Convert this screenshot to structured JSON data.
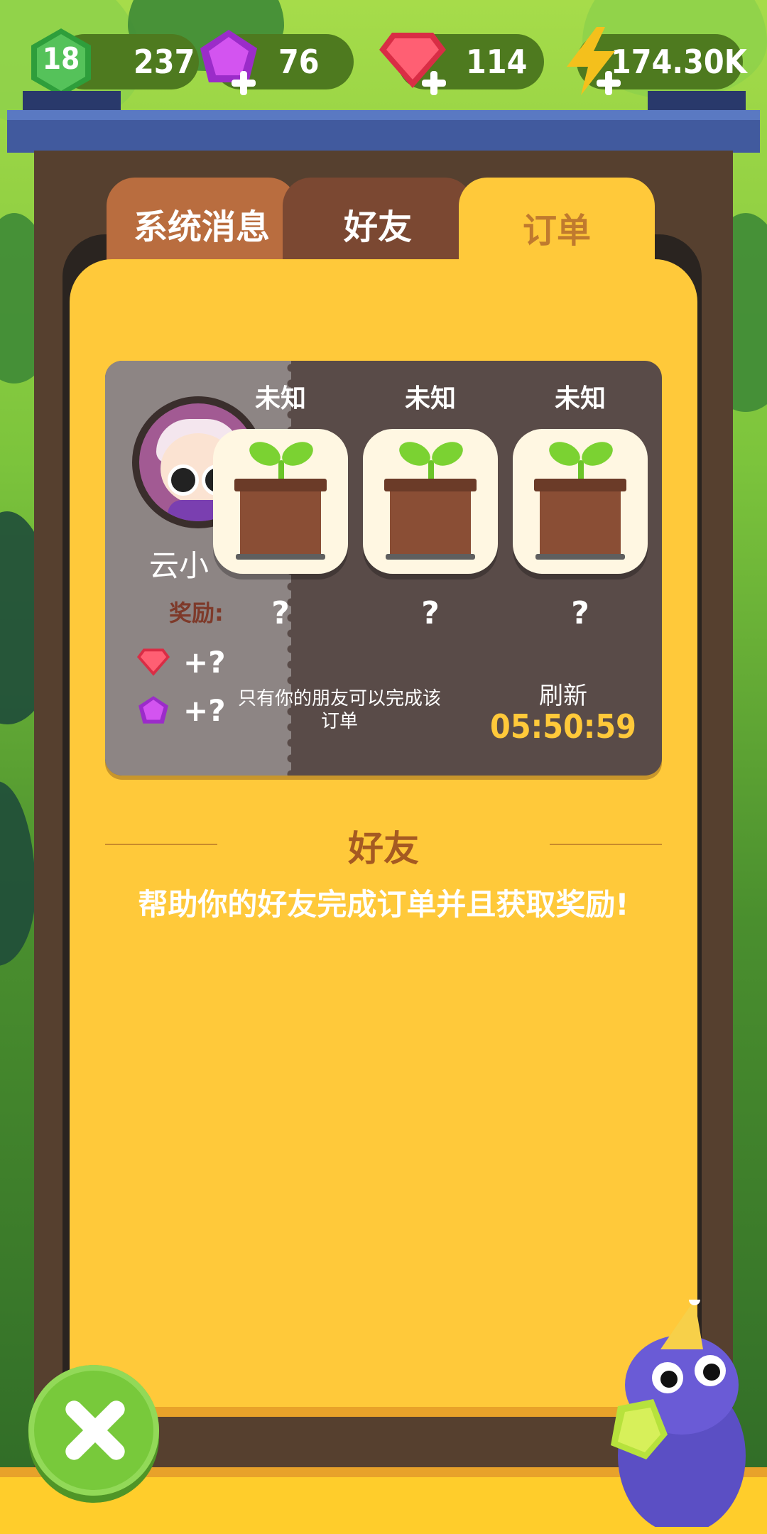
{
  "currency": {
    "level": "18",
    "xp": "237",
    "purple_gems": "76",
    "red_gems": "114",
    "energy": "174.30K"
  },
  "tabs": [
    {
      "label": "系统消息",
      "active": false
    },
    {
      "label": "好友",
      "active": false
    },
    {
      "label": "订单",
      "active": true
    }
  ],
  "order": {
    "friend_name": "云小",
    "reward_label": "奖励:",
    "reward_gem": "+?",
    "reward_purple": "+?",
    "slots": [
      {
        "label": "未知",
        "qty": "?"
      },
      {
        "label": "未知",
        "qty": "?"
      },
      {
        "label": "未知",
        "qty": "?"
      }
    ],
    "note": "只有你的朋友可以完成该订单",
    "refresh_label": "刷新",
    "refresh_time": "05:50:59"
  },
  "section": {
    "title": "好友",
    "description": "帮助你的好友完成订单并且获取奖励!"
  },
  "colors": {
    "panel": "#ffc93a",
    "card": "#594b48",
    "accent_time": "#ffc93a",
    "close_button": "#78c93b"
  },
  "icons": {
    "level": "hexagon-level-icon",
    "purple_gem": "purple-gem-icon",
    "red_gem": "red-gem-icon",
    "energy": "lightning-icon",
    "close": "close-icon",
    "sprout": "sprout-pot-icon"
  }
}
